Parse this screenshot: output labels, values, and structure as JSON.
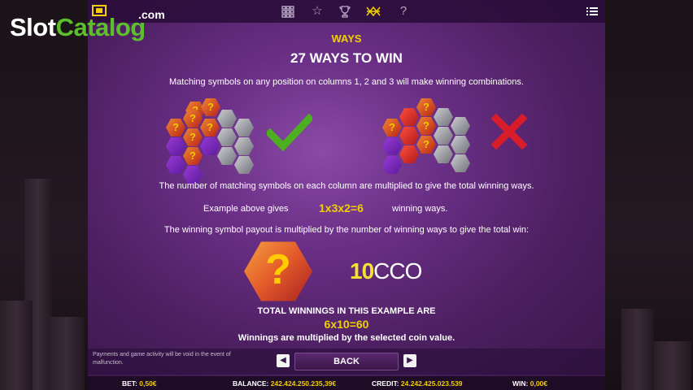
{
  "logo": {
    "slot": "Slot",
    "catalog": "Catalog",
    "com": ".com"
  },
  "topbar": {
    "icons": [
      "paytable-icon",
      "star-icon",
      "trophy-icon",
      "ways-icon",
      "help-icon"
    ],
    "menu_icon": "menu-icon"
  },
  "heading": {
    "label": "WAYS",
    "title": "27 WAYS TO WIN"
  },
  "text": {
    "matching": "Matching symbols on any position on columns 1, 2 and 3 will make winning combinations.",
    "multiplied": "The number of matching symbols on each column are multiplied to give the total winning ways.",
    "example_prefix": "Example above gives",
    "example_formula": "1x3x2=6",
    "example_suffix": "winning ways.",
    "payout": "The winning symbol payout is multiplied by the number of winning ways to give the total win:",
    "total_label": "TOTAL WINNINGS IN THIS EXAMPLE ARE",
    "total_formula": "6x10=60",
    "coin_note": "Winnings are multiplied by the selected coin value."
  },
  "symbol_glyph": "?",
  "payout_value": {
    "number": "10",
    "suffix": "CCO"
  },
  "footnote": "Payments and game activity will be void in the event of malfunction.",
  "nav": {
    "back": "BACK",
    "prev_glyph": "◀",
    "next_glyph": "▶"
  },
  "status": {
    "bet_label": "BET:",
    "bet_value": "0,50€",
    "balance_label": "BALANCE:",
    "balance_value": "242.424.250.235,39€",
    "credit_label": "CREDIT:",
    "credit_value": "24.242.425.023.539",
    "win_label": "WIN:",
    "win_value": "0,00€"
  },
  "colors": {
    "accent_yellow": "#f0d000",
    "check_green": "#4caf20",
    "cross_red": "#d81c2a",
    "panel_purple": "#6a2f86"
  }
}
